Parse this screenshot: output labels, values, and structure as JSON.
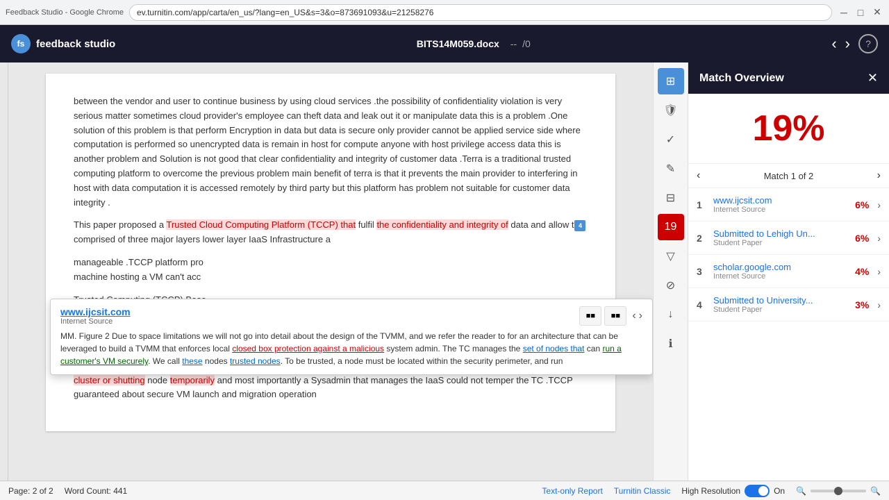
{
  "browser": {
    "title": "Feedback Studio - Google Chrome",
    "url": "ev.turnitin.com/app/carta/en_us/?lang=en_US&s=3&o=873691093&u=21258276",
    "window_controls": [
      "minimize",
      "maximize",
      "close"
    ]
  },
  "header": {
    "logo_text": "feedback studio",
    "filename": "BITS14M059.docx",
    "page_display": "--",
    "page_total": "/0",
    "help_label": "?"
  },
  "document": {
    "paragraphs": [
      "between the vendor and user to continue business by using cloud services .the possibility of confidentiality violation is very serious matter sometimes cloud provider's employee can theft data and leak out it or manipulate data this is a problem .One solution of this problem is that perform Encryption in data but data is secure only provider cannot be applied service side where computation is performed so unencrypted data is remain in host for compute anyone with host privilege access data this is another problem and Solution is not good that clear confidentiality and integrity of customer data .Terra is a traditional trusted computing platform to overcome the previous problem main benefit of terra is that it prevents the main provider to interfering in host with data computation it is accessed remotely by third party but this platform has problem not suitable for customer data integrity ."
    ],
    "highlighted_sentence": "This paper proposed a Trusted Cloud Computing Platform (TCCP) that fulfil the confidentiality and integrity of data and allow t",
    "paragraph2": "comprised of three major layers lower layer IaaS Infrastructure a",
    "paragraph3": "manageable .TCCP platform pro machine hosting a VM can't acc",
    "paragraph4_label": "Trusted Computing (TCCP) Base (TVMM) , and a Trusted Coordin",
    "paragraph5": "Each node in backend run in TVMM and hosts the customer VM's and also protects its own integrity and complies with TCCP protocols .TCCP enforces closed box protection against a malicious sysadmin .TC manage set of nodes that run customer VM securely called these are trusted nodes .TC can also perform Occurrence of event such as adding node removing node on cluster or shutting node temporarily and most importantly a Sysadmin that manages the IaaS could not temper the TC .TCCP guaranteed about secure VM launch and migration operation"
  },
  "popup": {
    "url": "www.ijcsit.com",
    "source_type": "Internet Source",
    "text": "MM. Figure 2 Due to space limitations we will not go into detail about the design of the TVMM, and we refer the reader to for an architecture that can be leveraged to build a TVMM that enforces local closed box protection against a malicious system admin. The TC manages the set of nodes that can run a customer's VM securely. We call these nodes trusted nodes. To be trusted, a node must be located within the security perimeter, and run"
  },
  "match_overview": {
    "title": "Match Overview",
    "percentage": "19%",
    "nav_label": "Match 1 of 2",
    "matches": [
      {
        "num": "1",
        "source": "www.ijcsit.com",
        "type": "Internet Source",
        "percent": "6%"
      },
      {
        "num": "2",
        "source": "Submitted to Lehigh Un...",
        "type": "Student Paper",
        "percent": "6%"
      },
      {
        "num": "3",
        "source": "scholar.google.com",
        "type": "Internet Source",
        "percent": "4%"
      },
      {
        "num": "4",
        "source": "Submitted to University...",
        "type": "Student Paper",
        "percent": "3%"
      }
    ]
  },
  "status_bar": {
    "page_info": "Page: 2 of 2",
    "word_count": "Word Count: 441",
    "text_only_report": "Text-only Report",
    "turnitin_classic": "Turnitin Classic",
    "high_resolution_label": "High Resolution",
    "toggle_state": "On",
    "zoom_icon": "🔍"
  },
  "sidebar_icons": [
    {
      "name": "layers",
      "symbol": "⊞",
      "active": true
    },
    {
      "name": "shield",
      "symbol": "🛡",
      "active": false
    },
    {
      "name": "check",
      "symbol": "✓",
      "active": false
    },
    {
      "name": "edit",
      "symbol": "✎",
      "active": false
    },
    {
      "name": "grid",
      "symbol": "⊟",
      "active": false
    },
    {
      "name": "flag-red",
      "symbol": "19",
      "badge": true
    },
    {
      "name": "filter",
      "symbol": "▼",
      "active": false
    },
    {
      "name": "block",
      "symbol": "⊘",
      "active": false
    },
    {
      "name": "download",
      "symbol": "↓",
      "active": false
    },
    {
      "name": "info",
      "symbol": "ℹ",
      "active": false
    }
  ]
}
